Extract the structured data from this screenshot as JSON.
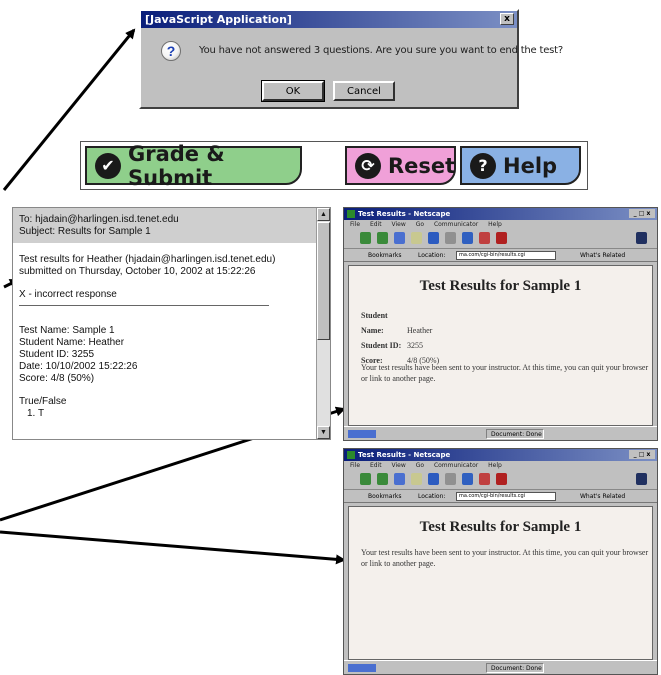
{
  "dialog": {
    "title": "[JavaScript Application]",
    "close": "x",
    "icon": "?",
    "message": "You have not answered 3 questions.  Are you sure you want to end the test?",
    "ok_label": "OK",
    "cancel_label": "Cancel"
  },
  "buttons": {
    "grade": {
      "label": "Grade & Submit",
      "icon": "check-icon"
    },
    "reset": {
      "label": "Reset",
      "icon": "refresh-icon"
    },
    "help": {
      "label": "Help",
      "icon": "question-icon"
    }
  },
  "email": {
    "to": "To: hjadain@harlingen.isd.tenet.edu",
    "subject": "Subject: Results for Sample 1",
    "intro1": "Test results for Heather (hjadain@harlingen.isd.tenet.edu)",
    "intro2": "submitted on Thursday, October 10, 2002 at 15:22:26",
    "legend": "X - incorrect response",
    "test_name": "Test Name: Sample 1",
    "student_name": "Student Name: Heather",
    "student_id": "Student ID: 3255",
    "date": "Date: 10/10/2002 15:22:26",
    "score": "Score: 4/8 (50%)",
    "section": "True/False",
    "item1": "1. T"
  },
  "netscape": {
    "window_title": "Test Results - Netscape",
    "controls": "_ □ x",
    "menu": [
      "File",
      "Edit",
      "View",
      "Go",
      "Communicator",
      "Help"
    ],
    "bookmarks": "Bookmarks",
    "location_label": "Location:",
    "url": "ma.com/cgi-bin/results.cgi",
    "related": "What's Related",
    "status_text": "Document: Done",
    "page_title": "Test Results for Sample 1",
    "student_name_label": "Student Name:",
    "student_name_value": "Heather",
    "student_id_label": "Student ID:",
    "student_id_value": "3255",
    "score_label": "Score:",
    "score_value": "4/8 (50%)",
    "note": "Your test results have been sent to your instructor.  At this time, you can quit your browser or link to another page."
  },
  "colors": {
    "grade_bg": "#8fcf8b",
    "reset_bg": "#f0a0d8",
    "help_bg": "#8ab1e4",
    "titlebar": "#0a1e7a"
  }
}
